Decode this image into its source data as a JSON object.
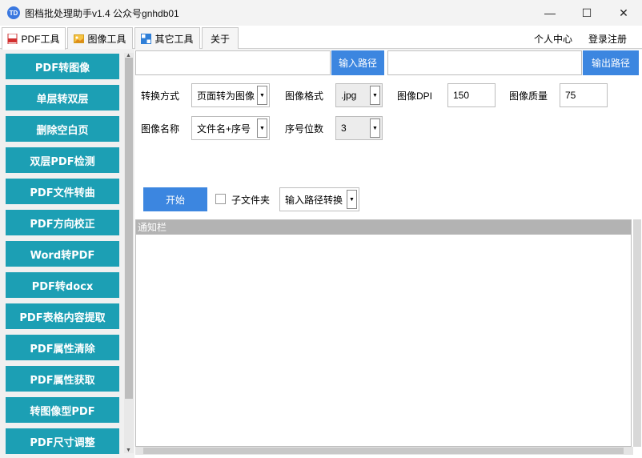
{
  "window": {
    "icon_text": "TD",
    "title": "图档批处理助手v1.4 公众号gnhdb01",
    "minimize": "—",
    "maximize": "☐",
    "close": "✕"
  },
  "tabs": [
    {
      "label": "PDF工具",
      "active": true
    },
    {
      "label": "图像工具",
      "active": false
    },
    {
      "label": "其它工具",
      "active": false
    },
    {
      "label": "关于",
      "active": false
    }
  ],
  "top_right": {
    "profile": "个人中心",
    "login": "登录注册"
  },
  "sidebar": {
    "items": [
      "PDF转图像",
      "单层转双层",
      "删除空白页",
      "双层PDF检测",
      "PDF文件转曲",
      "PDF方向校正",
      "Word转PDF",
      "PDF转docx",
      "PDF表格内容提取",
      "PDF属性清除",
      "PDF属性获取",
      "转图像型PDF",
      "PDF尺寸调整"
    ]
  },
  "paths": {
    "input_path_value": "",
    "input_path_button": "输入路径",
    "output_path_value": "",
    "output_path_button": "输出路径"
  },
  "options": {
    "convert_mode_label": "转换方式",
    "convert_mode_value": "页面转为图像",
    "image_format_label": "图像格式",
    "image_format_value": ".jpg",
    "dpi_label": "图像DPI",
    "dpi_value": "150",
    "quality_label": "图像质量",
    "quality_value": "75",
    "image_name_label": "图像名称",
    "image_name_value": "文件名+序号",
    "seq_digits_label": "序号位数",
    "seq_digits_value": "3"
  },
  "actions": {
    "start": "开始",
    "subfolder_label": "子文件夹",
    "subfolder_checked": false,
    "output_mode_value": "输入路径转换"
  },
  "notice": {
    "header": "通知栏",
    "content": ""
  },
  "colors": {
    "sidebar_button": "#1c9fb4",
    "accent_blue": "#3c86e0"
  }
}
